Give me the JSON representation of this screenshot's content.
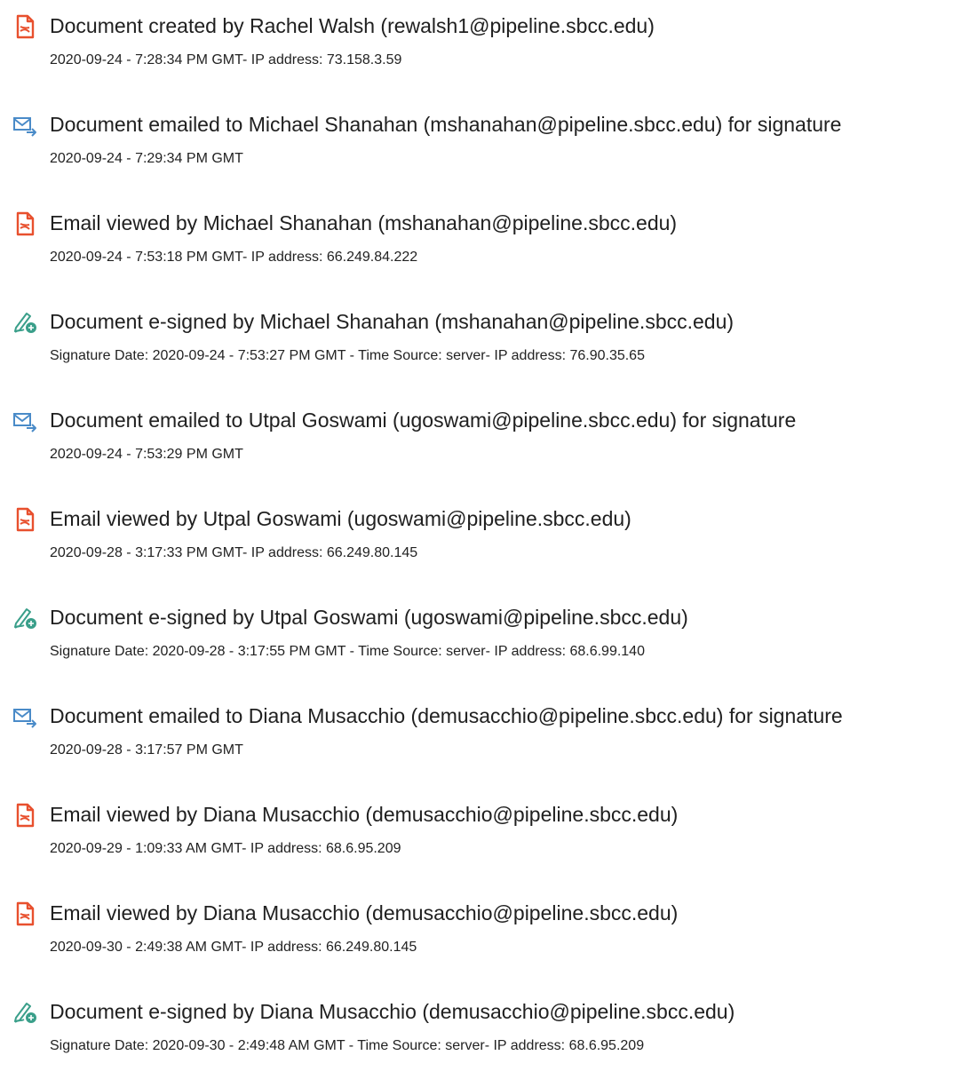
{
  "colors": {
    "viewed_icon": "#e8502e",
    "emailed_icon": "#4a8bc8",
    "signed_icon": "#3a9f8a",
    "text": "#222222"
  },
  "events": [
    {
      "type": "created",
      "icon": "document-icon",
      "title": "Document created by Rachel Walsh (rewalsh1@pipeline.sbcc.edu)",
      "detail": "2020-09-24 - 7:28:34 PM GMT- IP address: 73.158.3.59"
    },
    {
      "type": "emailed",
      "icon": "email-sent-icon",
      "title": "Document emailed to Michael Shanahan (mshanahan@pipeline.sbcc.edu) for signature",
      "detail": "2020-09-24 - 7:29:34 PM GMT"
    },
    {
      "type": "viewed",
      "icon": "document-icon",
      "title": "Email viewed by Michael Shanahan (mshanahan@pipeline.sbcc.edu)",
      "detail": "2020-09-24 - 7:53:18 PM GMT- IP address: 66.249.84.222"
    },
    {
      "type": "signed",
      "icon": "pen-sign-icon",
      "title": "Document e-signed by Michael Shanahan (mshanahan@pipeline.sbcc.edu)",
      "detail": "Signature Date: 2020-09-24 - 7:53:27 PM GMT - Time Source: server- IP address: 76.90.35.65"
    },
    {
      "type": "emailed",
      "icon": "email-sent-icon",
      "title": "Document emailed to Utpal Goswami (ugoswami@pipeline.sbcc.edu) for signature",
      "detail": "2020-09-24 - 7:53:29 PM GMT"
    },
    {
      "type": "viewed",
      "icon": "document-icon",
      "title": "Email viewed by Utpal Goswami (ugoswami@pipeline.sbcc.edu)",
      "detail": "2020-09-28 - 3:17:33 PM GMT- IP address: 66.249.80.145"
    },
    {
      "type": "signed",
      "icon": "pen-sign-icon",
      "title": "Document e-signed by Utpal Goswami (ugoswami@pipeline.sbcc.edu)",
      "detail": "Signature Date: 2020-09-28 - 3:17:55 PM GMT - Time Source: server- IP address: 68.6.99.140"
    },
    {
      "type": "emailed",
      "icon": "email-sent-icon",
      "title": "Document emailed to Diana Musacchio (demusacchio@pipeline.sbcc.edu) for signature",
      "detail": "2020-09-28 - 3:17:57 PM GMT"
    },
    {
      "type": "viewed",
      "icon": "document-icon",
      "title": "Email viewed by Diana Musacchio (demusacchio@pipeline.sbcc.edu)",
      "detail": "2020-09-29 - 1:09:33 AM GMT- IP address: 68.6.95.209"
    },
    {
      "type": "viewed",
      "icon": "document-icon",
      "title": "Email viewed by Diana Musacchio (demusacchio@pipeline.sbcc.edu)",
      "detail": "2020-09-30 - 2:49:38 AM GMT- IP address: 66.249.80.145"
    },
    {
      "type": "signed",
      "icon": "pen-sign-icon",
      "title": "Document e-signed by Diana Musacchio (demusacchio@pipeline.sbcc.edu)",
      "detail": "Signature Date: 2020-09-30 - 2:49:48 AM GMT - Time Source: server- IP address: 68.6.95.209"
    }
  ]
}
